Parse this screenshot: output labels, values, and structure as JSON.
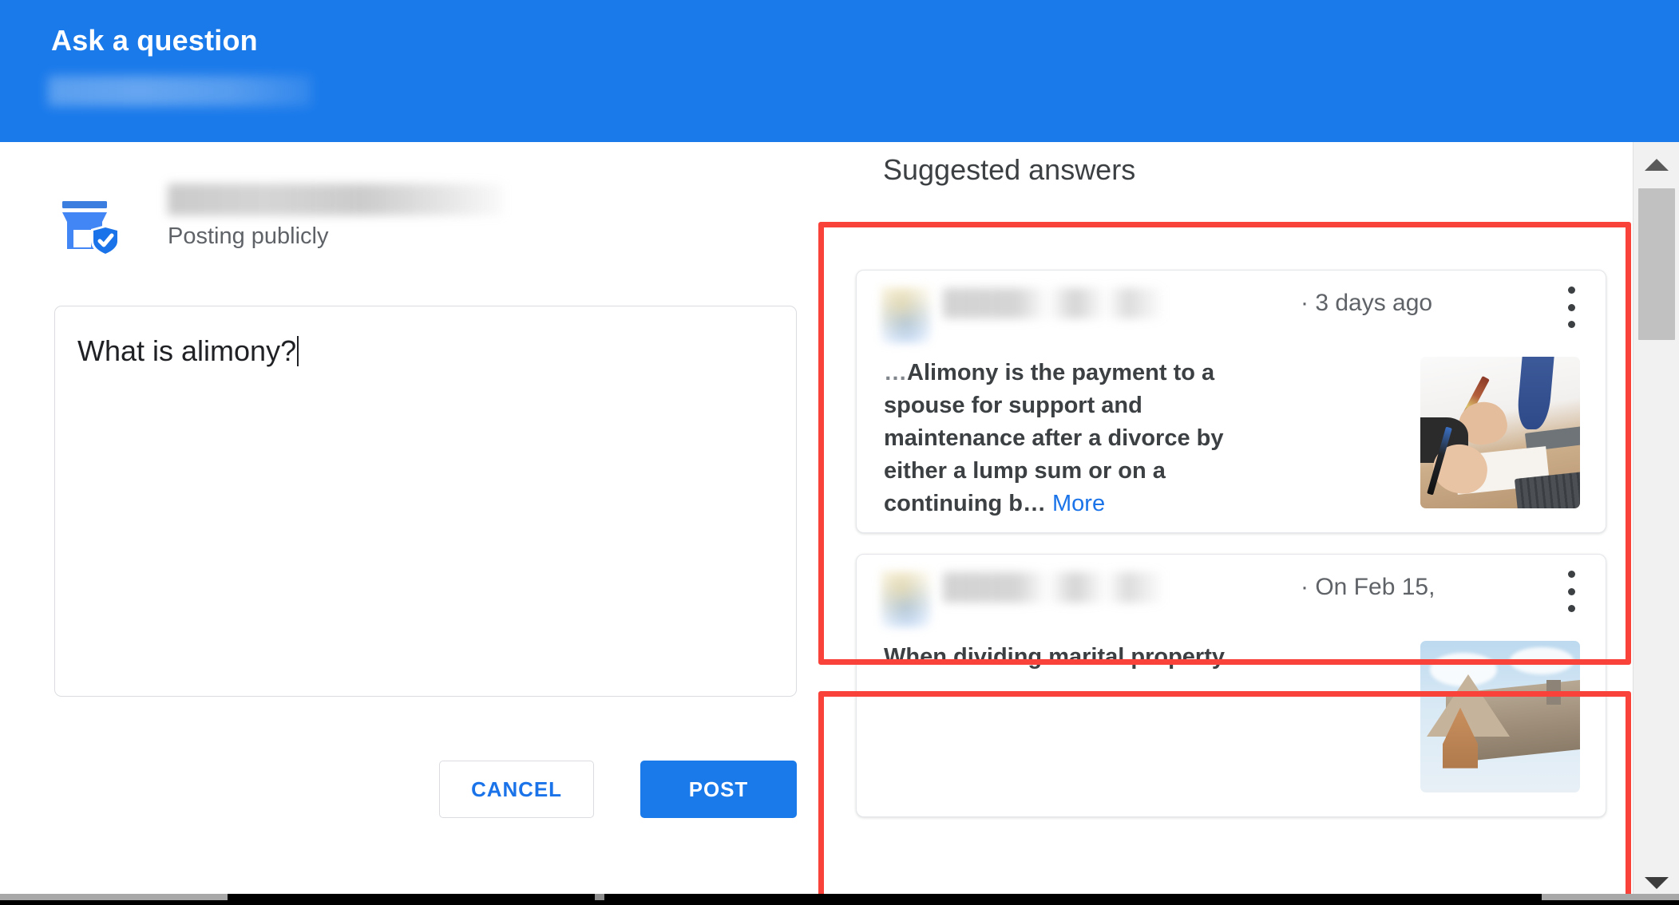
{
  "header": {
    "title": "Ask a question",
    "subtitle_redacted": "",
    "background_color": "#1B7AEA"
  },
  "compose": {
    "store_icon": "storefront-verified-icon",
    "author_name_redacted": "",
    "visibility_label": "Posting publicly",
    "question_value": "What is alimony?",
    "question_placeholder": "",
    "cancel_label": "CANCEL",
    "post_label": "POST",
    "accent_color": "#1A73E8"
  },
  "suggested": {
    "title": "Suggested answers",
    "answers": [
      {
        "author_redacted": "",
        "date": "· 3 days ago",
        "menu_icon": "more-vert-icon",
        "text_lead": "…",
        "text": "Alimony is the payment to a spouse for support and maintenance after a divorce by either a lump sum or on a continuing b… ",
        "more_label": "More",
        "thumbnail": "people-signing-documents-photo"
      },
      {
        "author_redacted": "",
        "date": "· On Feb 15,",
        "menu_icon": "more-vert-icon",
        "text_lead": "",
        "text": "When dividing marital property",
        "more_label": "",
        "thumbnail": "house-exterior-photo"
      }
    ]
  },
  "scrollbar": {
    "up_icon": "triangle-up-icon",
    "down_icon": "triangle-down-icon",
    "thumb": "scroll-thumb"
  },
  "annotations": {
    "color": "#F9423A",
    "boxes": [
      "suggested-answer-1-highlight",
      "suggested-answer-2-highlight"
    ]
  }
}
